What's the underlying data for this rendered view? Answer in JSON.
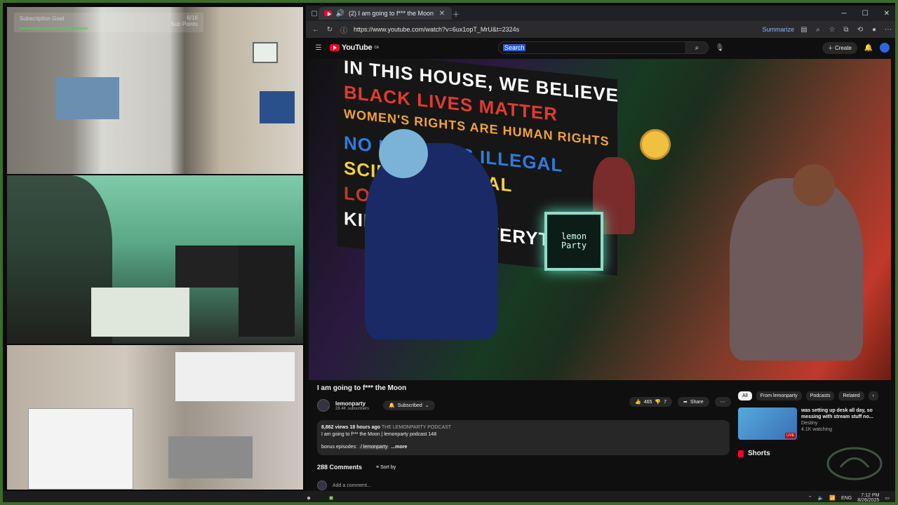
{
  "overlay": {
    "goal_label": "Subscription Goal",
    "goal_count_line1": "6/16",
    "goal_count_line2": "Sub Points",
    "goal_progress": 0.38
  },
  "browser": {
    "tab_title": "(2) I am going to f*** the Moon",
    "url": "https://www.youtube.com/watch?v=6ux1opT_MrU&t=2324s",
    "summarize_label": "Summarize"
  },
  "youtube": {
    "logo_text": "YouTube",
    "logo_region": "CA",
    "search_placeholder": "Search",
    "create_label": "Create",
    "video_title": "I am going to f*** the Moon",
    "channel_name": "lemonparty",
    "channel_subs": "28.4K subscribers",
    "subscribed_label": "Subscribed",
    "likes": "465",
    "dislikes": "7",
    "share_label": "Share",
    "desc_views": "8,862 views",
    "desc_age": "18 hours ago",
    "desc_tag": "THE LEMONPARTY PODCAST",
    "desc_line2": "I am going to f*** the Moon | lemonparty podcast 148",
    "desc_line3_prefix": "bonus episodes:",
    "desc_line3_link": "/ lemonparty",
    "desc_more": "...more",
    "comments_count": "288 Comments",
    "sort_label": "Sort by",
    "add_comment_placeholder": "Add a comment...",
    "tv_line1": "lemon",
    "tv_line2": "Party",
    "banner_lines": [
      "IN THIS HOUSE, WE BELIEVE",
      "BLACK LIVES MATTER",
      "WOMEN'S RIGHTS ARE HUMAN RIGHTS",
      "NO HUMAN IS ILLEGAL",
      "SCIENCE IS REAL",
      "LOVE IS LOVE",
      "KINDNESS IS EVERYTHING"
    ],
    "banner_colors": [
      "#ffffff",
      "#e23b2f",
      "#f2a23a",
      "#2d7be0",
      "#f4d03f",
      "#c0392b",
      "#ffffff"
    ]
  },
  "sidebar": {
    "chips": [
      "All",
      "From lemonparty",
      "Podcasts",
      "Related"
    ],
    "rec_title": "was setting up desk all day, so messing with stream stuff no...",
    "rec_channel": "Destiny",
    "rec_watching": "4.1K watching",
    "live_label": "LIVE",
    "shorts_label": "Shorts"
  },
  "taskbar": {
    "lang": "ENG",
    "time": "7:12 PM",
    "date": "8/26/2025"
  }
}
